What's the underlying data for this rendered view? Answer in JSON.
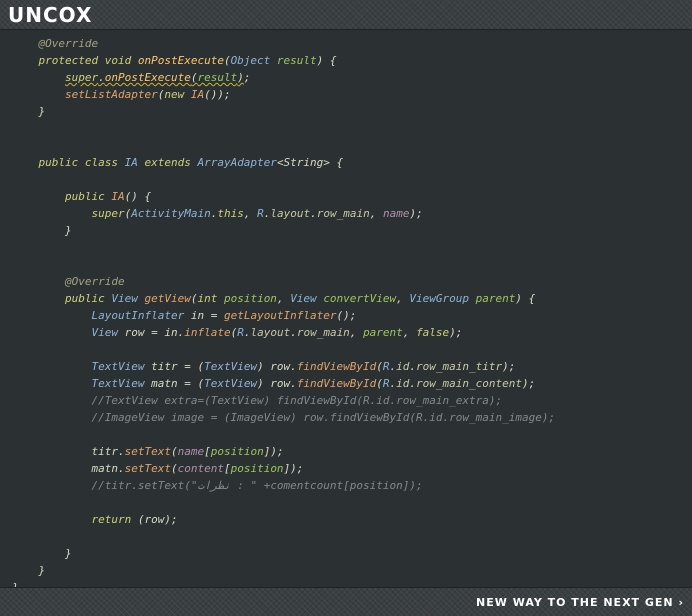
{
  "header": {
    "brand": "UNCOX"
  },
  "footer": {
    "slogan": "NEW WAY TO THE NEXT GEN ›"
  },
  "colors": {
    "background": "#2b3133",
    "bar": "#3a3f41",
    "keyword": "#cc7832",
    "method": "#ffc66d",
    "type": "#8fb3d6",
    "comment": "#80898c"
  },
  "code_lines": [
    [
      {
        "t": "    "
      },
      {
        "t": "@Override",
        "c": "ann"
      }
    ],
    [
      {
        "t": "    "
      },
      {
        "t": "protected void ",
        "c": "kw2"
      },
      {
        "t": "onPostExecute",
        "c": "fn"
      },
      {
        "t": "(",
        "c": "plain"
      },
      {
        "t": "Object",
        "c": "typ"
      },
      {
        "t": " result",
        "c": "prm"
      },
      {
        "t": ") {",
        "c": "plain"
      }
    ],
    [
      {
        "t": "        "
      },
      {
        "t": "super",
        "c": "kw2",
        "u": true
      },
      {
        "t": ".",
        "c": "plain",
        "u": true
      },
      {
        "t": "onPostExecute",
        "c": "fn",
        "u": true
      },
      {
        "t": "(",
        "c": "plain",
        "u": true
      },
      {
        "t": "result",
        "c": "prm",
        "u": true
      },
      {
        "t": ")",
        "c": "plain",
        "u": true
      },
      {
        "t": ";",
        "c": "plain"
      }
    ],
    [
      {
        "t": "        "
      },
      {
        "t": "setListAdapter",
        "c": "fn2"
      },
      {
        "t": "(",
        "c": "plain"
      },
      {
        "t": "new ",
        "c": "kw2"
      },
      {
        "t": "IA",
        "c": "fn2"
      },
      {
        "t": "());",
        "c": "plain"
      }
    ],
    [
      {
        "t": "    "
      },
      {
        "t": "}",
        "c": "plain"
      }
    ],
    [],
    [],
    [
      {
        "t": "    "
      },
      {
        "t": "public class ",
        "c": "kw2"
      },
      {
        "t": "IA ",
        "c": "typ"
      },
      {
        "t": "extends ",
        "c": "kw2"
      },
      {
        "t": "ArrayAdapter",
        "c": "typ"
      },
      {
        "t": "<String> {",
        "c": "plain"
      }
    ],
    [],
    [
      {
        "t": "        "
      },
      {
        "t": "public ",
        "c": "kw2"
      },
      {
        "t": "IA",
        "c": "fn2"
      },
      {
        "t": "() {",
        "c": "plain"
      }
    ],
    [
      {
        "t": "            "
      },
      {
        "t": "super",
        "c": "kw2"
      },
      {
        "t": "(",
        "c": "plain"
      },
      {
        "t": "ActivityMain",
        "c": "typ"
      },
      {
        "t": ".",
        "c": "plain"
      },
      {
        "t": "this",
        "c": "kw2"
      },
      {
        "t": ", ",
        "c": "plain"
      },
      {
        "t": "R",
        "c": "typ"
      },
      {
        "t": ".",
        "c": "plain"
      },
      {
        "t": "layout",
        "c": "fld"
      },
      {
        "t": ".",
        "c": "plain"
      },
      {
        "t": "row_main",
        "c": "fld"
      },
      {
        "t": ", ",
        "c": "plain"
      },
      {
        "t": "name",
        "c": "vr"
      },
      {
        "t": ");",
        "c": "plain"
      }
    ],
    [
      {
        "t": "        "
      },
      {
        "t": "}",
        "c": "plain"
      }
    ],
    [],
    [],
    [
      {
        "t": "        "
      },
      {
        "t": "@Override",
        "c": "ann"
      }
    ],
    [
      {
        "t": "        "
      },
      {
        "t": "public ",
        "c": "kw2"
      },
      {
        "t": "View ",
        "c": "typ"
      },
      {
        "t": "getView",
        "c": "fn2"
      },
      {
        "t": "(",
        "c": "plain"
      },
      {
        "t": "int ",
        "c": "kw2"
      },
      {
        "t": "position",
        "c": "prm"
      },
      {
        "t": ", ",
        "c": "plain"
      },
      {
        "t": "View ",
        "c": "typ"
      },
      {
        "t": "convertView",
        "c": "prm"
      },
      {
        "t": ", ",
        "c": "plain"
      },
      {
        "t": "ViewGroup ",
        "c": "typ"
      },
      {
        "t": "parent",
        "c": "prm"
      },
      {
        "t": ") {",
        "c": "plain"
      }
    ],
    [
      {
        "t": "            "
      },
      {
        "t": "LayoutInflater ",
        "c": "typ"
      },
      {
        "t": "in = ",
        "c": "plain"
      },
      {
        "t": "getLayoutInflater",
        "c": "fn2"
      },
      {
        "t": "();",
        "c": "plain"
      }
    ],
    [
      {
        "t": "            "
      },
      {
        "t": "View ",
        "c": "typ"
      },
      {
        "t": "row = in.",
        "c": "plain"
      },
      {
        "t": "inflate",
        "c": "fn2"
      },
      {
        "t": "(",
        "c": "plain"
      },
      {
        "t": "R",
        "c": "typ"
      },
      {
        "t": ".",
        "c": "plain"
      },
      {
        "t": "layout",
        "c": "fld"
      },
      {
        "t": ".",
        "c": "plain"
      },
      {
        "t": "row_main",
        "c": "fld"
      },
      {
        "t": ", ",
        "c": "plain"
      },
      {
        "t": "parent",
        "c": "prm"
      },
      {
        "t": ", ",
        "c": "plain"
      },
      {
        "t": "false",
        "c": "kw2"
      },
      {
        "t": ");",
        "c": "plain"
      }
    ],
    [],
    [
      {
        "t": "            "
      },
      {
        "t": "TextView ",
        "c": "typ"
      },
      {
        "t": "titr = (",
        "c": "plain"
      },
      {
        "t": "TextView",
        "c": "typ"
      },
      {
        "t": ") row.",
        "c": "plain"
      },
      {
        "t": "findViewById",
        "c": "fn2"
      },
      {
        "t": "(",
        "c": "plain"
      },
      {
        "t": "R",
        "c": "typ"
      },
      {
        "t": ".",
        "c": "plain"
      },
      {
        "t": "id",
        "c": "fld"
      },
      {
        "t": ".",
        "c": "plain"
      },
      {
        "t": "row_main_titr",
        "c": "fld"
      },
      {
        "t": ");",
        "c": "plain"
      }
    ],
    [
      {
        "t": "            "
      },
      {
        "t": "TextView ",
        "c": "typ"
      },
      {
        "t": "matn = (",
        "c": "plain"
      },
      {
        "t": "TextView",
        "c": "typ"
      },
      {
        "t": ") row.",
        "c": "plain"
      },
      {
        "t": "findViewById",
        "c": "fn2"
      },
      {
        "t": "(",
        "c": "plain"
      },
      {
        "t": "R",
        "c": "typ"
      },
      {
        "t": ".",
        "c": "plain"
      },
      {
        "t": "id",
        "c": "fld"
      },
      {
        "t": ".",
        "c": "plain"
      },
      {
        "t": "row_main_content",
        "c": "fld"
      },
      {
        "t": ");",
        "c": "plain"
      }
    ],
    [
      {
        "t": "            "
      },
      {
        "t": "//TextView extra=(TextView) findViewById(R.id.row_main_extra);",
        "c": "cm"
      }
    ],
    [
      {
        "t": "            "
      },
      {
        "t": "//ImageView image = (ImageView) row.findViewById(R.id.row_main_image);",
        "c": "cm"
      }
    ],
    [],
    [
      {
        "t": "            "
      },
      {
        "t": "titr.",
        "c": "plain"
      },
      {
        "t": "setText",
        "c": "fn2"
      },
      {
        "t": "(",
        "c": "plain"
      },
      {
        "t": "name",
        "c": "vr"
      },
      {
        "t": "[",
        "c": "plain"
      },
      {
        "t": "position",
        "c": "prm"
      },
      {
        "t": "]);",
        "c": "plain"
      }
    ],
    [
      {
        "t": "            "
      },
      {
        "t": "matn.",
        "c": "plain"
      },
      {
        "t": "setText",
        "c": "fn2"
      },
      {
        "t": "(",
        "c": "plain"
      },
      {
        "t": "content",
        "c": "vr"
      },
      {
        "t": "[",
        "c": "plain"
      },
      {
        "t": "position",
        "c": "prm"
      },
      {
        "t": "]);",
        "c": "plain"
      }
    ],
    [
      {
        "t": "            "
      },
      {
        "t": "//titr.setText(\"نظرات : \" +comentcount[position]);",
        "c": "cm"
      }
    ],
    [],
    [
      {
        "t": "            "
      },
      {
        "t": "return ",
        "c": "kw2"
      },
      {
        "t": "(row);",
        "c": "plain"
      }
    ],
    [],
    [
      {
        "t": "        "
      },
      {
        "t": "}",
        "c": "plain"
      }
    ],
    [
      {
        "t": "    "
      },
      {
        "t": "}",
        "c": "plain"
      }
    ],
    [
      {
        "t": "}",
        "c": "plain"
      }
    ]
  ]
}
